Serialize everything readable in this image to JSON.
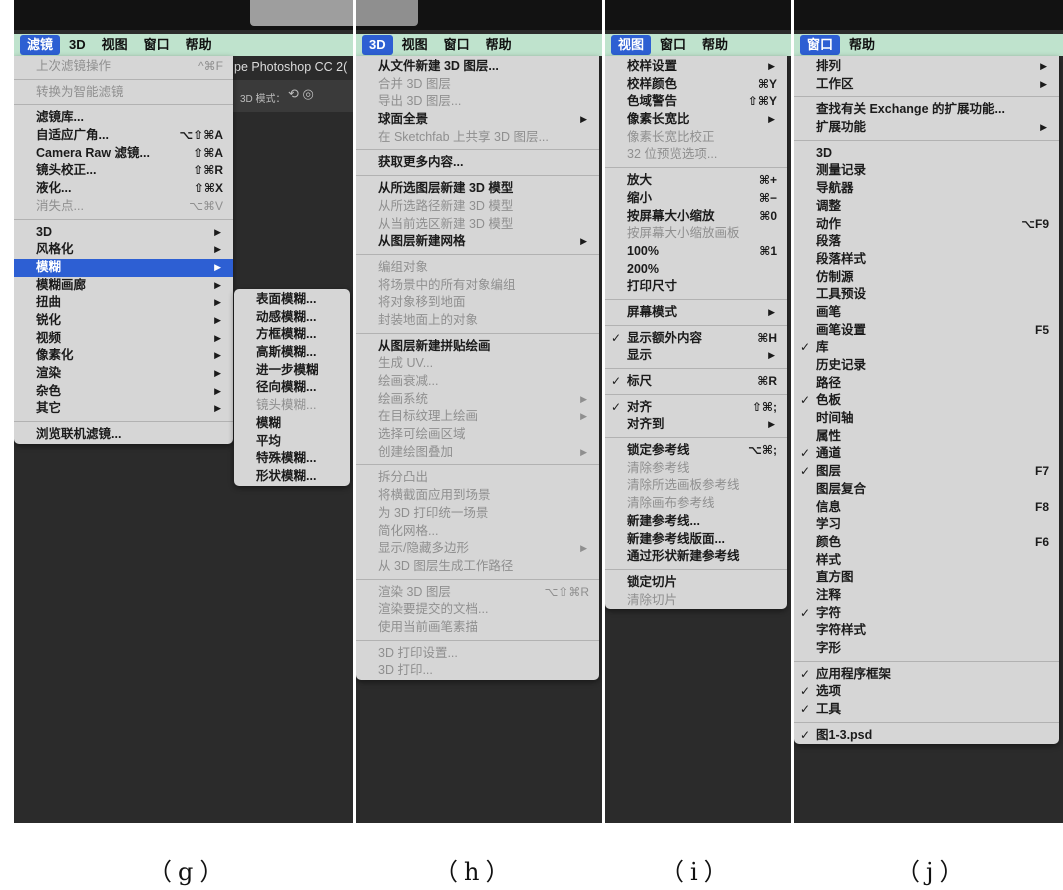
{
  "panels": {
    "g": {
      "caption": "（g）",
      "menubar": [
        "滤镜",
        "3D",
        "视图",
        "窗口",
        "帮助"
      ],
      "bg_title": "pe Photoshop CC 2(",
      "bg_3d_mode": "3D 模式：",
      "menu": [
        {
          "label": "上次滤镜操作",
          "shortcut": "^⌘F",
          "disabled": true
        },
        {
          "sep": true
        },
        {
          "label": "转换为智能滤镜",
          "disabled": true
        },
        {
          "sep": true
        },
        {
          "label": "滤镜库..."
        },
        {
          "label": "自适应广角...",
          "shortcut": "⌥⇧⌘A"
        },
        {
          "label": "Camera Raw 滤镜...",
          "shortcut": "⇧⌘A"
        },
        {
          "label": "镜头校正...",
          "shortcut": "⇧⌘R"
        },
        {
          "label": "液化...",
          "shortcut": "⇧⌘X"
        },
        {
          "label": "消失点...",
          "shortcut": "⌥⌘V",
          "disabled": true
        },
        {
          "sep": true
        },
        {
          "label": "3D",
          "submenu": true
        },
        {
          "label": "风格化",
          "submenu": true
        },
        {
          "label": "模糊",
          "submenu": true,
          "highlighted": true
        },
        {
          "label": "模糊画廊",
          "submenu": true
        },
        {
          "label": "扭曲",
          "submenu": true
        },
        {
          "label": "锐化",
          "submenu": true
        },
        {
          "label": "视频",
          "submenu": true
        },
        {
          "label": "像素化",
          "submenu": true
        },
        {
          "label": "渲染",
          "submenu": true
        },
        {
          "label": "杂色",
          "submenu": true
        },
        {
          "label": "其它",
          "submenu": true
        },
        {
          "sep": true
        },
        {
          "label": "浏览联机滤镜..."
        }
      ],
      "submenu": [
        {
          "label": "表面模糊..."
        },
        {
          "label": "动感模糊..."
        },
        {
          "label": "方框模糊..."
        },
        {
          "label": "高斯模糊..."
        },
        {
          "label": "进一步模糊"
        },
        {
          "label": "径向模糊..."
        },
        {
          "label": "镜头模糊...",
          "disabled": true
        },
        {
          "label": "模糊"
        },
        {
          "label": "平均"
        },
        {
          "label": "特殊模糊..."
        },
        {
          "label": "形状模糊..."
        }
      ]
    },
    "h": {
      "caption": "（h）",
      "menubar": [
        "3D",
        "视图",
        "窗口",
        "帮助"
      ],
      "menu": [
        {
          "label": "从文件新建 3D 图层..."
        },
        {
          "label": "合并 3D 图层",
          "disabled": true
        },
        {
          "label": "导出 3D 图层...",
          "disabled": true
        },
        {
          "label": "球面全景",
          "submenu": true
        },
        {
          "label": "在 Sketchfab 上共享 3D 图层...",
          "disabled": true
        },
        {
          "sep": true
        },
        {
          "label": "获取更多内容..."
        },
        {
          "sep": true
        },
        {
          "label": "从所选图层新建 3D 模型"
        },
        {
          "label": "从所选路径新建 3D 模型",
          "disabled": true
        },
        {
          "label": "从当前选区新建 3D 模型",
          "disabled": true
        },
        {
          "label": "从图层新建网格",
          "submenu": true
        },
        {
          "sep": true
        },
        {
          "label": "编组对象",
          "disabled": true
        },
        {
          "label": "将场景中的所有对象编组",
          "disabled": true
        },
        {
          "label": "将对象移到地面",
          "disabled": true
        },
        {
          "label": "封装地面上的对象",
          "disabled": true
        },
        {
          "sep": true
        },
        {
          "label": "从图层新建拼贴绘画"
        },
        {
          "label": "生成 UV...",
          "disabled": true
        },
        {
          "label": "绘画衰减...",
          "disabled": true
        },
        {
          "label": "绘画系统",
          "submenu": true,
          "disabled": true
        },
        {
          "label": "在目标纹理上绘画",
          "submenu": true,
          "disabled": true
        },
        {
          "label": "选择可绘画区域",
          "disabled": true
        },
        {
          "label": "创建绘图叠加",
          "submenu": true,
          "disabled": true
        },
        {
          "sep": true
        },
        {
          "label": "拆分凸出",
          "disabled": true
        },
        {
          "label": "将横截面应用到场景",
          "disabled": true
        },
        {
          "label": "为 3D 打印统一场景",
          "disabled": true
        },
        {
          "label": "简化网格...",
          "disabled": true
        },
        {
          "label": "显示/隐藏多边形",
          "submenu": true,
          "disabled": true
        },
        {
          "label": "从 3D 图层生成工作路径",
          "disabled": true
        },
        {
          "sep": true
        },
        {
          "label": "渲染 3D 图层",
          "shortcut": "⌥⇧⌘R",
          "disabled": true
        },
        {
          "label": "渲染要提交的文档...",
          "disabled": true
        },
        {
          "label": "使用当前画笔素描",
          "disabled": true
        },
        {
          "sep": true
        },
        {
          "label": "3D 打印设置...",
          "disabled": true
        },
        {
          "label": "3D 打印...",
          "disabled": true
        }
      ]
    },
    "i": {
      "caption": "（i）",
      "menubar": [
        "视图",
        "窗口",
        "帮助"
      ],
      "menu": [
        {
          "label": "校样设置",
          "submenu": true
        },
        {
          "label": "校样颜色",
          "shortcut": "⌘Y"
        },
        {
          "label": "色域警告",
          "shortcut": "⇧⌘Y"
        },
        {
          "label": "像素长宽比",
          "submenu": true
        },
        {
          "label": "像素长宽比校正",
          "disabled": true
        },
        {
          "label": "32 位预览选项...",
          "disabled": true
        },
        {
          "sep": true
        },
        {
          "label": "放大",
          "shortcut": "⌘+"
        },
        {
          "label": "缩小",
          "shortcut": "⌘−"
        },
        {
          "label": "按屏幕大小缩放",
          "shortcut": "⌘0"
        },
        {
          "label": "按屏幕大小缩放画板",
          "disabled": true
        },
        {
          "label": "100%",
          "shortcut": "⌘1"
        },
        {
          "label": "200%"
        },
        {
          "label": "打印尺寸"
        },
        {
          "sep": true
        },
        {
          "label": "屏幕模式",
          "submenu": true
        },
        {
          "sep": true
        },
        {
          "label": "显示额外内容",
          "shortcut": "⌘H",
          "checked": true
        },
        {
          "label": "显示",
          "submenu": true
        },
        {
          "sep": true
        },
        {
          "label": "标尺",
          "shortcut": "⌘R",
          "checked": true
        },
        {
          "sep": true
        },
        {
          "label": "对齐",
          "shortcut": "⇧⌘;",
          "checked": true
        },
        {
          "label": "对齐到",
          "submenu": true
        },
        {
          "sep": true
        },
        {
          "label": "锁定参考线",
          "shortcut": "⌥⌘;"
        },
        {
          "label": "清除参考线",
          "disabled": true
        },
        {
          "label": "清除所选画板参考线",
          "disabled": true
        },
        {
          "label": "清除画布参考线",
          "disabled": true
        },
        {
          "label": "新建参考线..."
        },
        {
          "label": "新建参考线版面..."
        },
        {
          "label": "通过形状新建参考线"
        },
        {
          "sep": true
        },
        {
          "label": "锁定切片"
        },
        {
          "label": "清除切片",
          "disabled": true
        }
      ]
    },
    "j": {
      "caption": "（j）",
      "menubar": [
        "窗口",
        "帮助"
      ],
      "menu": [
        {
          "label": "排列",
          "submenu": true
        },
        {
          "label": "工作区",
          "submenu": true
        },
        {
          "sep": true
        },
        {
          "label": "查找有关 Exchange 的扩展功能..."
        },
        {
          "label": "扩展功能",
          "submenu": true
        },
        {
          "sep": true
        },
        {
          "label": "3D"
        },
        {
          "label": "测量记录"
        },
        {
          "label": "导航器"
        },
        {
          "label": "调整"
        },
        {
          "label": "动作",
          "shortcut": "⌥F9"
        },
        {
          "label": "段落"
        },
        {
          "label": "段落样式"
        },
        {
          "label": "仿制源"
        },
        {
          "label": "工具预设"
        },
        {
          "label": "画笔"
        },
        {
          "label": "画笔设置",
          "shortcut": "F5"
        },
        {
          "label": "库",
          "checked": true
        },
        {
          "label": "历史记录"
        },
        {
          "label": "路径"
        },
        {
          "label": "色板",
          "checked": true
        },
        {
          "label": "时间轴"
        },
        {
          "label": "属性"
        },
        {
          "label": "通道",
          "checked": true
        },
        {
          "label": "图层",
          "shortcut": "F7",
          "checked": true
        },
        {
          "label": "图层复合"
        },
        {
          "label": "信息",
          "shortcut": "F8"
        },
        {
          "label": "学习"
        },
        {
          "label": "颜色",
          "shortcut": "F6"
        },
        {
          "label": "样式"
        },
        {
          "label": "直方图"
        },
        {
          "label": "注释"
        },
        {
          "label": "字符",
          "checked": true
        },
        {
          "label": "字符样式"
        },
        {
          "label": "字形"
        },
        {
          "sep": true
        },
        {
          "label": "应用程序框架",
          "checked": true
        },
        {
          "label": "选项",
          "checked": true
        },
        {
          "label": "工具",
          "checked": true
        },
        {
          "sep": true
        },
        {
          "label": "图1-3.psd",
          "checked": true
        }
      ]
    }
  }
}
